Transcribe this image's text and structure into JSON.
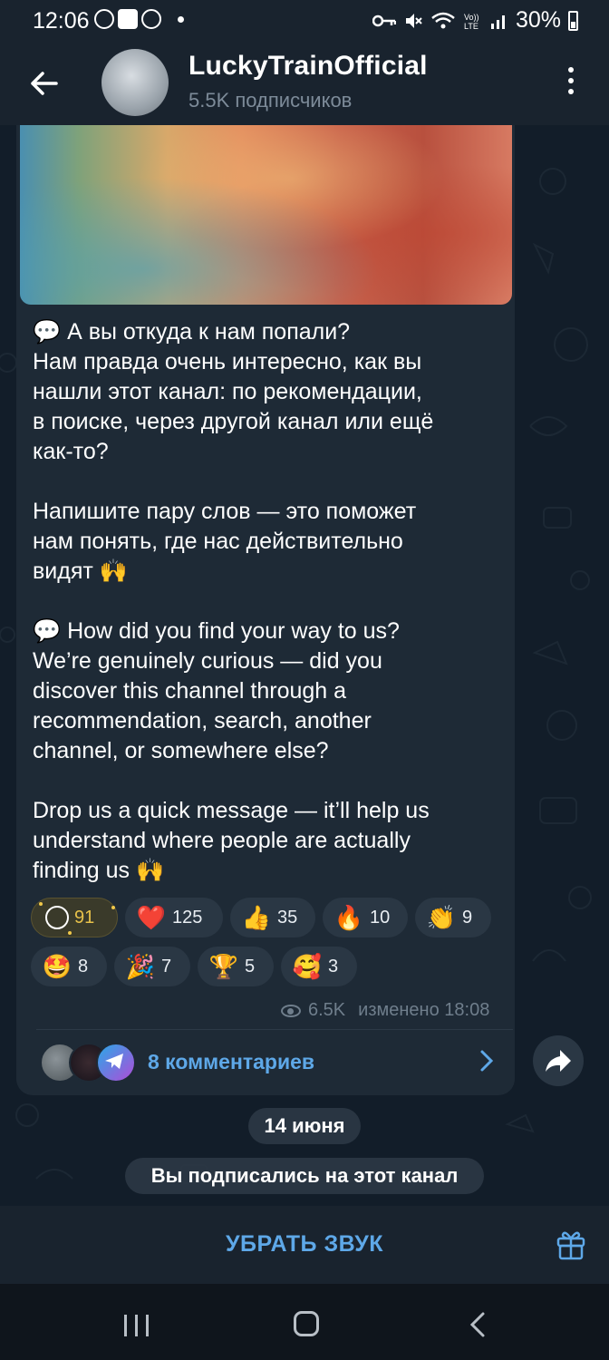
{
  "status_bar": {
    "time": "12:06",
    "battery": "30%",
    "icons": [
      "whatsapp-icon",
      "gallery-icon",
      "whatsapp-icon",
      "dot-icon",
      "key-icon",
      "mute-icon",
      "wifi-icon",
      "volte-icon",
      "signal-icon",
      "battery-icon"
    ]
  },
  "header": {
    "title": "LuckyTrainOfficial",
    "subtitle": "5.5K подписчиков"
  },
  "message": {
    "paragraphs": [
      [
        "💬 А вы откуда к нам попали?",
        "Нам правда очень интересно, как вы",
        "нашли этот канал: по рекомендации,",
        "в поиске, через другой канал или ещё",
        "как-то?"
      ],
      [
        "Напишите пару слов — это поможет",
        "нам понять, где нас действительно",
        "видят 🙌"
      ],
      [
        "💬 How did you find your way to us?",
        "We’re genuinely curious — did you",
        "discover this channel through a",
        "recommendation, search, another",
        "channel, or somewhere else?"
      ],
      [
        "Drop us a quick message — it’ll help us",
        "understand where people are actually",
        "finding us 🙌"
      ]
    ],
    "reactions": [
      {
        "emoji": "",
        "count": "91"
      },
      {
        "emoji": "❤️",
        "count": "125"
      },
      {
        "emoji": "👍",
        "count": "35"
      },
      {
        "emoji": "🔥",
        "count": "10"
      },
      {
        "emoji": "👏",
        "count": "9"
      },
      {
        "emoji": "🤩",
        "count": "8"
      },
      {
        "emoji": "🎉",
        "count": "7"
      },
      {
        "emoji": "🏆",
        "count": "5"
      },
      {
        "emoji": "🥰",
        "count": "3"
      }
    ],
    "views": "6.5K",
    "edited": "изменено 18:08",
    "comments_label": "8 комментариев"
  },
  "date_pill": "14 июня",
  "service_message": "Вы подписались на этот канал",
  "bottom_bar": {
    "mute_label": "УБРАТЬ ЗВУК"
  },
  "colors": {
    "accent": "#5ea8e8",
    "bubble": "#1e2a36",
    "background": "#0e1621"
  }
}
